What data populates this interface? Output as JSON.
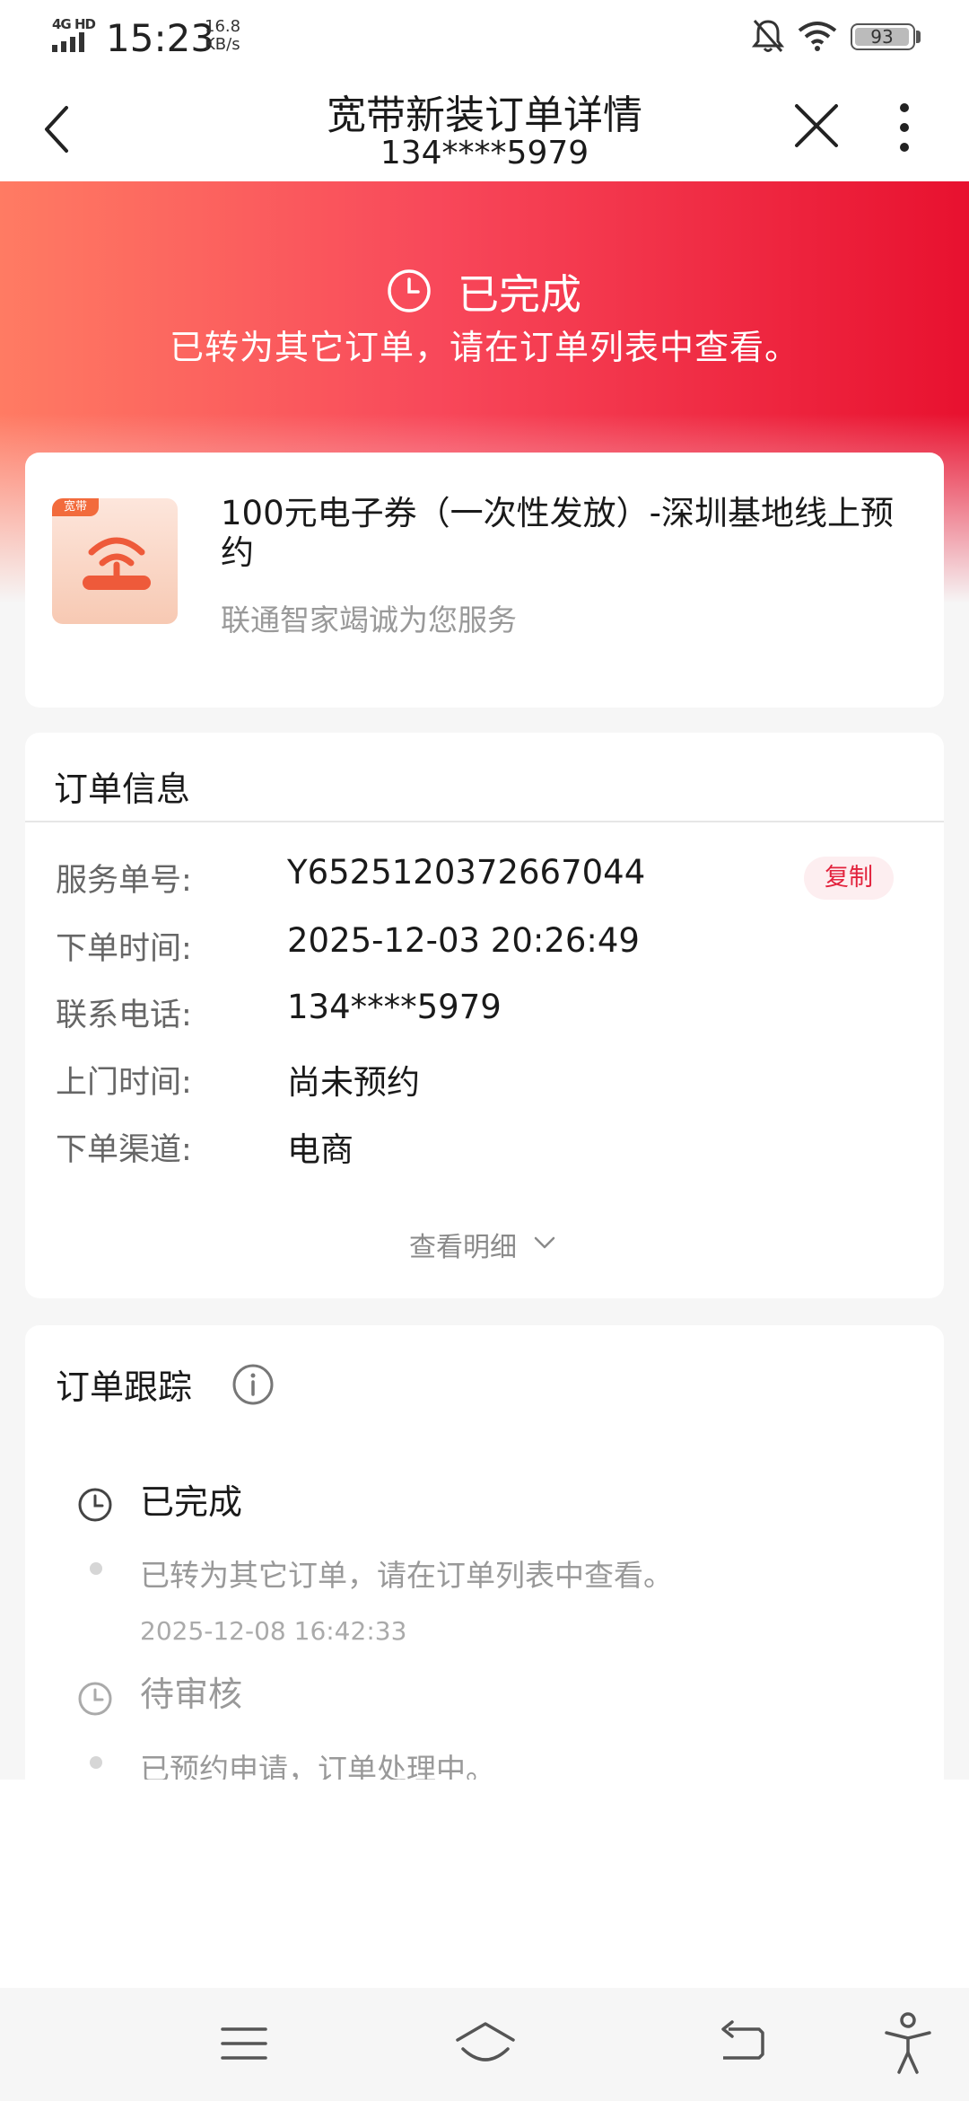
{
  "status_bar": {
    "network": "4G HD",
    "time": "15:23",
    "speed_value": "16.8",
    "speed_unit": "KB/s",
    "battery": "93"
  },
  "header": {
    "title": "宽带新装订单详情",
    "subtitle": "134****5979"
  },
  "hero": {
    "status": "已完成",
    "message": "已转为其它订单，请在订单列表中查看。",
    "gradient_colors": [
      "#ff7b63",
      "#f8485a",
      "#e8112f"
    ]
  },
  "product": {
    "tag": "宽带",
    "name": "100元电子券（一次性发放）-深圳基地线上预约",
    "desc": "联通智家竭诚为您服务"
  },
  "order_info": {
    "title": "订单信息",
    "rows": [
      {
        "label": "服务单号:",
        "value": "Y6525120372667044"
      },
      {
        "label": "下单时间:",
        "value": "2025-12-03 20:26:49"
      },
      {
        "label": "联系电话:",
        "value": "134****5979"
      },
      {
        "label": "上门时间:",
        "value": "尚未预约"
      },
      {
        "label": "下单渠道:",
        "value": "电商"
      }
    ],
    "copy_label": "复制",
    "detail_label": "查看明细"
  },
  "tracking": {
    "title": "订单跟踪",
    "events": [
      {
        "status": "已完成",
        "text": "已转为其它订单，请在订单列表中查看。",
        "time": "2025-12-08 16:42:33"
      },
      {
        "status": "待审核",
        "text": "已预约申请，订单处理中。"
      }
    ]
  },
  "colors": {
    "accent": "#e2233d",
    "copy_bg": "#fdeef0"
  }
}
